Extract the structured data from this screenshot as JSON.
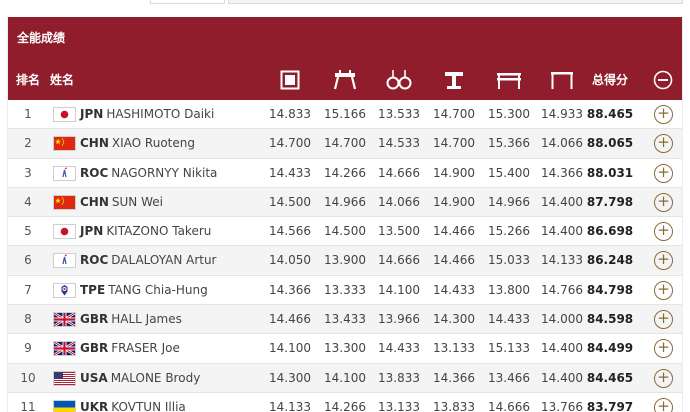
{
  "panel": {
    "title": "全能成绩"
  },
  "columns": {
    "rank": "排名",
    "name": "姓名",
    "total": "总得分",
    "apparatus": [
      {
        "icon": "floor-exercise-icon"
      },
      {
        "icon": "pommel-horse-icon"
      },
      {
        "icon": "rings-icon"
      },
      {
        "icon": "vault-icon"
      },
      {
        "icon": "parallel-bars-icon"
      },
      {
        "icon": "horizontal-bar-icon"
      }
    ],
    "collapse_icon": "minus-circle-icon"
  },
  "colors": {
    "header": "#8f1d2c",
    "expand": "#8a6a3a",
    "alt_row": "#f4f4f4"
  },
  "rows": [
    {
      "rank": "1",
      "noc": "JPN",
      "name": "HASHIMOTO Daiki",
      "flag": "jpn",
      "scores": [
        "14.833",
        "15.166",
        "13.533",
        "14.700",
        "15.300",
        "14.933"
      ],
      "total": "88.465"
    },
    {
      "rank": "2",
      "noc": "CHN",
      "name": "XIAO Ruoteng",
      "flag": "chn",
      "scores": [
        "14.700",
        "14.700",
        "14.533",
        "14.700",
        "15.366",
        "14.066"
      ],
      "total": "88.065"
    },
    {
      "rank": "3",
      "noc": "ROC",
      "name": "NAGORNYY Nikita",
      "flag": "roc",
      "scores": [
        "14.433",
        "14.266",
        "14.666",
        "14.900",
        "15.400",
        "14.366"
      ],
      "total": "88.031"
    },
    {
      "rank": "4",
      "noc": "CHN",
      "name": "SUN Wei",
      "flag": "chn",
      "scores": [
        "14.500",
        "14.966",
        "14.066",
        "14.900",
        "14.966",
        "14.400"
      ],
      "total": "87.798"
    },
    {
      "rank": "5",
      "noc": "JPN",
      "name": "KITAZONO Takeru",
      "flag": "jpn",
      "scores": [
        "14.566",
        "14.500",
        "13.500",
        "14.466",
        "15.266",
        "14.400"
      ],
      "total": "86.698"
    },
    {
      "rank": "6",
      "noc": "ROC",
      "name": "DALALOYAN Artur",
      "flag": "roc",
      "scores": [
        "14.050",
        "13.900",
        "14.666",
        "14.466",
        "15.033",
        "14.133"
      ],
      "total": "86.248"
    },
    {
      "rank": "7",
      "noc": "TPE",
      "name": "TANG Chia-Hung",
      "flag": "tpe",
      "scores": [
        "14.366",
        "13.333",
        "14.100",
        "14.433",
        "13.800",
        "14.766"
      ],
      "total": "84.798"
    },
    {
      "rank": "8",
      "noc": "GBR",
      "name": "HALL James",
      "flag": "gbr",
      "scores": [
        "14.466",
        "13.433",
        "13.966",
        "14.300",
        "14.433",
        "14.000"
      ],
      "total": "84.598"
    },
    {
      "rank": "9",
      "noc": "GBR",
      "name": "FRASER Joe",
      "flag": "gbr",
      "scores": [
        "14.100",
        "13.300",
        "14.433",
        "13.133",
        "15.133",
        "14.400"
      ],
      "total": "84.499"
    },
    {
      "rank": "10",
      "noc": "USA",
      "name": "MALONE Brody",
      "flag": "usa",
      "scores": [
        "14.300",
        "14.100",
        "13.833",
        "14.366",
        "13.466",
        "14.400"
      ],
      "total": "84.465"
    },
    {
      "rank": "11",
      "noc": "UKR",
      "name": "KOVTUN Illia",
      "flag": "ukr",
      "scores": [
        "14.133",
        "14.266",
        "13.133",
        "13.833",
        "14.666",
        "13.766"
      ],
      "total": "83.797"
    }
  ]
}
